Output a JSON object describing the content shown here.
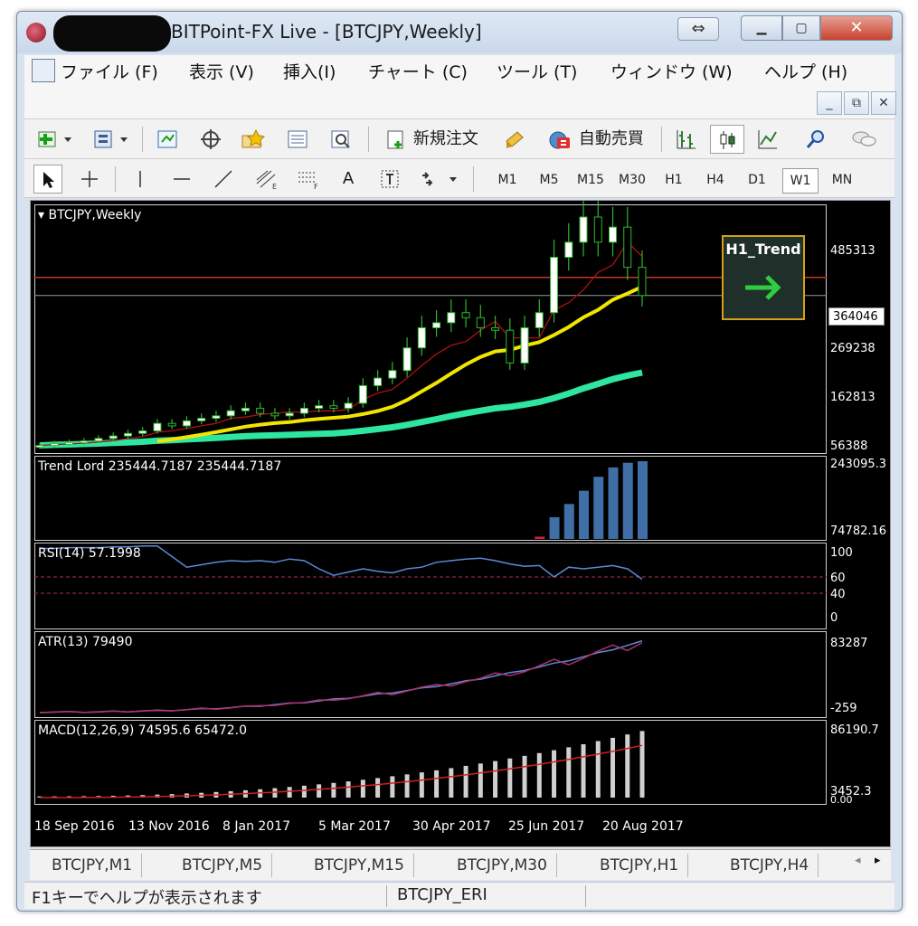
{
  "window": {
    "title": "BITPoint-FX Live - [BTCJPY,Weekly]"
  },
  "menu": {
    "items": [
      "ファイル (F)",
      "表示 (V)",
      "挿入(I)",
      "チャート (C)",
      "ツール (T)",
      "ウィンドウ (W)",
      "ヘルプ (H)"
    ]
  },
  "toolbar": {
    "new_order": "新規注文",
    "auto_trade": "自動売買",
    "text_tool": "A",
    "timeframes": [
      "M1",
      "M5",
      "M15",
      "M30",
      "H1",
      "H4",
      "D1",
      "W1",
      "MN"
    ],
    "active_timeframe": "W1"
  },
  "chart": {
    "symbol_label": "BTCJPY,Weekly",
    "current_price": "364046",
    "price_ticks": [
      "485313",
      "269238",
      "162813",
      "56388"
    ],
    "trend_panel_title": "H1_Trend",
    "trend_direction": "up-right arrow",
    "panes": {
      "trend_lord": {
        "label": "Trend Lord 235444.7187 235444.7187",
        "ticks": [
          "243095.3",
          "74782.16"
        ]
      },
      "rsi": {
        "label": "RSI(14) 57.1998",
        "ticks": [
          "100",
          "60",
          "40",
          "0"
        ]
      },
      "atr": {
        "label": "ATR(13) 79490",
        "ticks": [
          "83287",
          "-259"
        ]
      },
      "macd": {
        "label": "MACD(12,26,9) 74595.6 65472.0",
        "ticks": [
          "86190.7",
          "3452.3",
          "0.00"
        ]
      }
    },
    "dates": [
      "18 Sep 2016",
      "13 Nov 2016",
      "8 Jan 2017",
      "5 Mar 2017",
      "30 Apr 2017",
      "25 Jun 2017",
      "20 Aug 2017"
    ],
    "colors": {
      "background": "#000000",
      "bull_candle": "#ffffff",
      "bear_candle": "#000000",
      "candle_wick": "#2db82d",
      "ma_fast": "#f2e600",
      "ma_slow": "#2ee6a0",
      "kijun": "#b01010",
      "trend_lord_bar": "#3f6fa6",
      "rsi_line": "#5b8bd6",
      "atr_line1": "#5b8bd6",
      "atr_line2": "#b0306a",
      "macd_hist": "#d0d0d0",
      "macd_signal": "#d02020",
      "level_line": "#c0392b",
      "trend_arrow": "#2ecc40"
    }
  },
  "tabs": [
    "BTCJPY,M1",
    "BTCJPY,M5",
    "BTCJPY,M15",
    "BTCJPY,M30",
    "BTCJPY,H1",
    "BTCJPY,H4"
  ],
  "status": {
    "help": "F1キーでヘルプが表示されます",
    "profile": "BTCJPY_ERI"
  },
  "chart_data": {
    "type": "line",
    "title": "BTCJPY,Weekly",
    "x_range": [
      "18 Sep 2016",
      "20 Aug 2017"
    ],
    "y_ticks": [
      56388,
      162813,
      269238,
      485313
    ],
    "current_price": 364046,
    "price_series": [
      {
        "name": "close",
        "values": [
          66000,
          70000,
          72000,
          75000,
          80000,
          85000,
          90000,
          95000,
          110000,
          105000,
          115000,
          120000,
          125000,
          135000,
          140000,
          130000,
          125000,
          130000,
          140000,
          145000,
          140000,
          150000,
          185000,
          200000,
          215000,
          260000,
          300000,
          310000,
          330000,
          320000,
          300000,
          295000,
          230000,
          300000,
          330000,
          440000,
          470000,
          520000,
          470000,
          500000,
          420000,
          364046
        ]
      }
    ],
    "rsi": {
      "name": "RSI(14)",
      "current": 57.1998,
      "levels": [
        60,
        40
      ]
    },
    "atr": {
      "name": "ATR(13)",
      "current": 79490
    },
    "macd": {
      "name": "MACD(12,26,9)",
      "main": 74595.6,
      "signal": 65472.0
    }
  }
}
